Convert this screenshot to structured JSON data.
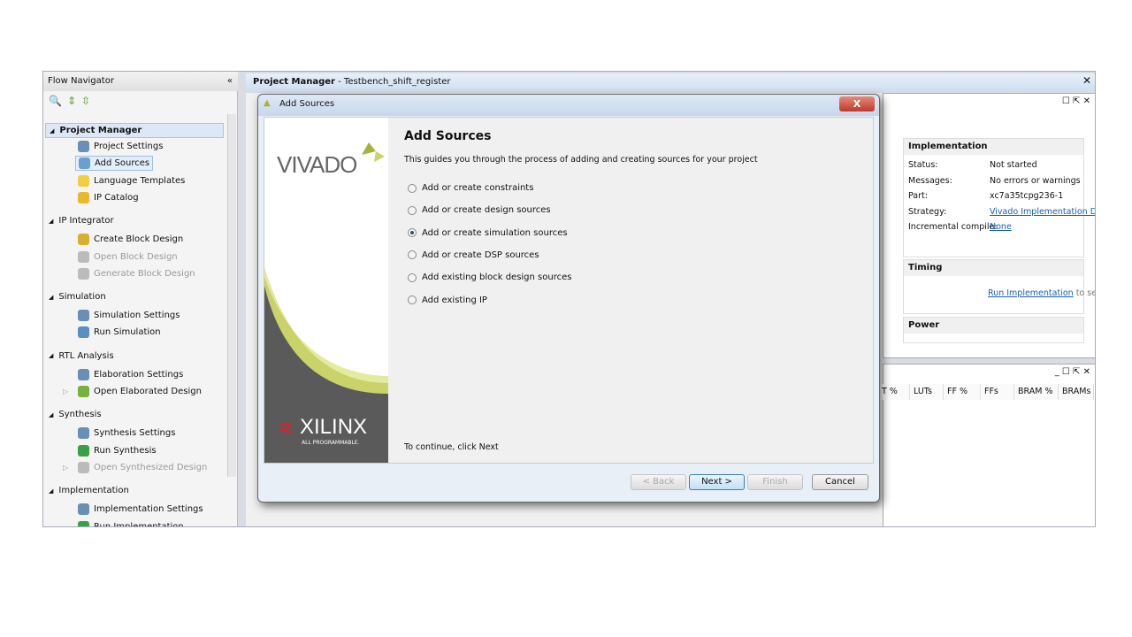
{
  "flow_navigator": {
    "title": "Flow Navigator",
    "collapse": "«",
    "sections": [
      {
        "label": "Project Manager",
        "items": [
          {
            "label": "Project Settings",
            "icon": "gear-icon"
          },
          {
            "label": "Add Sources",
            "icon": "add-sources-icon",
            "selected": true
          },
          {
            "label": "Language Templates",
            "icon": "lightbulb-icon"
          },
          {
            "label": "IP Catalog",
            "icon": "chip-icon"
          }
        ]
      },
      {
        "label": "IP Integrator",
        "items": [
          {
            "label": "Create Block Design",
            "icon": "create-block-icon"
          },
          {
            "label": "Open Block Design",
            "icon": "open-block-icon",
            "disabled": true
          },
          {
            "label": "Generate Block Design",
            "icon": "generate-icon",
            "disabled": true
          }
        ]
      },
      {
        "label": "Simulation",
        "items": [
          {
            "label": "Simulation Settings",
            "icon": "gear-icon"
          },
          {
            "label": "Run Simulation",
            "icon": "run-simulation-icon"
          }
        ]
      },
      {
        "label": "RTL Analysis",
        "items": [
          {
            "label": "Elaboration Settings",
            "icon": "gear-icon"
          },
          {
            "label": "Open Elaborated Design",
            "icon": "open-design-icon",
            "expandable": true
          }
        ]
      },
      {
        "label": "Synthesis",
        "items": [
          {
            "label": "Synthesis Settings",
            "icon": "gear-icon"
          },
          {
            "label": "Run Synthesis",
            "icon": "run-icon"
          },
          {
            "label": "Open Synthesized Design",
            "icon": "open-design-icon",
            "disabled": true,
            "expandable": true
          }
        ]
      },
      {
        "label": "Implementation",
        "items": [
          {
            "label": "Implementation Settings",
            "icon": "gear-icon"
          },
          {
            "label": "Run Implementation",
            "icon": "run-icon"
          }
        ]
      }
    ]
  },
  "main_header": {
    "title": "Project Manager",
    "subtitle": " - Testbench_shift_register"
  },
  "implementation": {
    "title": "Implementation",
    "rows": [
      {
        "k": "Status:",
        "v": "Not started"
      },
      {
        "k": "Messages:",
        "v": "No errors or warnings"
      },
      {
        "k": "Part:",
        "v": "xc7a35tcpg236-1"
      },
      {
        "k": "Strategy:",
        "v": "Vivado Implementation D",
        "link": true
      },
      {
        "k": "Incremental compile:",
        "v": "None",
        "link": true
      }
    ]
  },
  "timing": {
    "title": "Timing",
    "link": "Run Implementation",
    "suffix": " to se"
  },
  "power": {
    "title": "Power"
  },
  "utilization": {
    "columns": [
      "T %",
      "LUTs",
      "FF %",
      "FFs",
      "BRAM %",
      "BRAMs"
    ]
  },
  "dialog": {
    "title": "Add Sources",
    "close": "X",
    "heading": "Add Sources",
    "description": "This guides you through the process of adding and creating sources for your project",
    "options": [
      {
        "label": "Add or create constraints",
        "selected": false
      },
      {
        "label": "Add or create design sources",
        "selected": false
      },
      {
        "label": "Add or create simulation sources",
        "selected": true
      },
      {
        "label": "Add or create DSP sources",
        "selected": false
      },
      {
        "label": "Add existing block design sources",
        "selected": false
      },
      {
        "label": "Add existing IP",
        "selected": false
      }
    ],
    "footer": "To continue, click Next",
    "logo_vivado": "VIVADO",
    "logo_xilinx": "XILINX",
    "logo_tagline": "ALL PROGRAMMABLE.",
    "buttons": {
      "back": "< Back",
      "next": "Next >",
      "finish": "Finish",
      "cancel": "Cancel"
    }
  },
  "colors": {
    "accent": "#1a5fb4",
    "vivado_green": "#a4b33a",
    "xilinx_red": "#d22630"
  }
}
